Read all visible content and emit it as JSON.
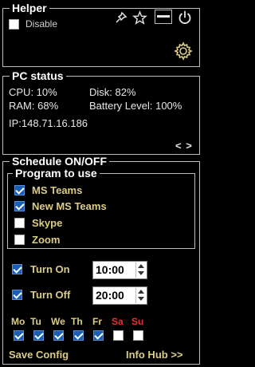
{
  "helper": {
    "title": "Helper",
    "disable_label": "Disable",
    "disable_checked": false
  },
  "pc_status": {
    "title": "PC status",
    "cpu": "CPU: 10%",
    "disk": "Disk: 82%",
    "ram": "RAM: 68%",
    "battery": "Battery Level: 100%",
    "ip": "IP:148.71.16.186",
    "nav": "< >"
  },
  "schedule": {
    "title": "Schedule ON/OFF",
    "program_title": "Program to use",
    "programs": [
      {
        "label": "MS Teams",
        "checked": true
      },
      {
        "label": "New MS Teams",
        "checked": true
      },
      {
        "label": "Skype",
        "checked": false
      },
      {
        "label": "Zoom",
        "checked": false
      }
    ],
    "turn_on_label": "Turn On",
    "turn_on_time": "10:00",
    "turn_off_label": "Turn Off",
    "turn_off_time": "20:00",
    "days": [
      {
        "label": "Mo",
        "checked": true
      },
      {
        "label": "Tu",
        "checked": true
      },
      {
        "label": "We",
        "checked": true
      },
      {
        "label": "Th",
        "checked": true
      },
      {
        "label": "Fr",
        "checked": true
      },
      {
        "label": "Sa",
        "checked": false
      },
      {
        "label": "Su",
        "checked": false
      }
    ],
    "save_config": "Save Config",
    "info_hub": "Info Hub >>"
  },
  "colors": {
    "accent_gold": "#dccc85",
    "weekend_red": "#e83030",
    "checkbox_blue": "#1a5fb4"
  }
}
